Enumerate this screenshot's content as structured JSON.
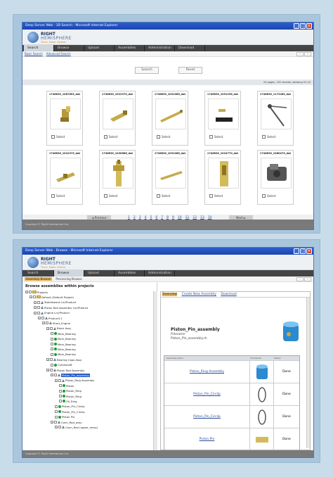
{
  "window1": {
    "title": "Deep Server Web - 3D Search - Microsoft Internet Explorer",
    "brand_line1": "RIGHT",
    "brand_line2": "HEMISPHERE",
    "brand_line3": "Think. Make. Deliver.",
    "tabs": [
      "Search",
      "Browse",
      "Upload",
      "Assemblies",
      "Administration",
      "Download"
    ],
    "subnav": {
      "basic": "Basic Search",
      "advanced": "Advanced Search"
    },
    "search_button": "Search",
    "reset_button": "Reset",
    "results_text": "10 pages, 152 records, showing 01-10",
    "items": [
      {
        "title": "1746630_1087853_dat",
        "select": "Select"
      },
      {
        "title": "1746630_1022370_dat",
        "select": "Select"
      },
      {
        "title": "1746630_1091066_dat",
        "select": "Select"
      },
      {
        "title": "1746630_1091236_dat",
        "select": "Select"
      },
      {
        "title": "1746630_1172260_dat",
        "select": "Select"
      },
      {
        "title": "1746630_1022379_dat",
        "select": "Select"
      },
      {
        "title": "1746630_1030666_dat",
        "select": "Select"
      },
      {
        "title": "1746630_1091066_dat",
        "select": "Select"
      },
      {
        "title": "1746630_1024770_dat",
        "select": "Select"
      },
      {
        "title": "1746630_1080470_dat",
        "select": "Select"
      }
    ],
    "pager": {
      "previous": "◄ Previous",
      "next": "Next ►",
      "pages": [
        "1",
        "2",
        "3",
        "4",
        "5",
        "6",
        "7",
        "8",
        "9",
        "10",
        "11",
        "12",
        "13",
        "14"
      ]
    },
    "footer": "Copyright © Right Hemisphere Ltd."
  },
  "window2": {
    "title": "Deep Server Web - Browse - Microsoft Internet Explorer",
    "brand_line1": "RIGHT",
    "brand_line2": "HEMISPHERE",
    "brand_line3": "Think. Make. Deliver.",
    "tabs": [
      "Search",
      "Browse",
      "Upload",
      "Assemblies",
      "Administration"
    ],
    "subnav": {
      "assembly": "Assembly Browse",
      "processing": "Processing Browse"
    },
    "left_title": "Browse assemblies within projects",
    "tree": [
      {
        "label": "Projects",
        "kind": "fold",
        "depth": 0
      },
      {
        "label": "Default (Default Project)",
        "kind": "fold",
        "depth": 1
      },
      {
        "label": "Stabilizeant Lnr/Product",
        "kind": "asm",
        "depth": 2
      },
      {
        "label": "Piston Rod Assembly Lnr/Product",
        "kind": "asm",
        "depth": 2
      },
      {
        "label": "Engine Lnr/Product",
        "kind": "asm",
        "depth": 2
      },
      {
        "label": "Product11",
        "kind": "asm",
        "depth": 3
      },
      {
        "label": "Short_Engine",
        "kind": "asm",
        "depth": 4
      },
      {
        "label": "Block Assy",
        "kind": "asm",
        "depth": 5
      },
      {
        "label": "Main_Bearing",
        "kind": "part",
        "depth": 6
      },
      {
        "label": "Main_Bearing",
        "kind": "part",
        "depth": 6
      },
      {
        "label": "Main_Bearing",
        "kind": "part",
        "depth": 6
      },
      {
        "label": "Main_Bearing",
        "kind": "part",
        "depth": 6
      },
      {
        "label": "Main_Bearing",
        "kind": "part",
        "depth": 6
      },
      {
        "label": "Bearing Caps Assy",
        "kind": "asm",
        "depth": 5
      },
      {
        "label": "Crankshaft",
        "kind": "part",
        "depth": 6
      },
      {
        "label": "Piston Rod Assembly",
        "kind": "asm",
        "depth": 5
      },
      {
        "label": "Piston_Pin_assembly",
        "kind": "asm",
        "depth": 6,
        "selected": true
      },
      {
        "label": "Piston_Ring Assembly",
        "kind": "asm",
        "depth": 7
      },
      {
        "label": "Piston",
        "kind": "part",
        "depth": 8
      },
      {
        "label": "Piston_Ring",
        "kind": "part",
        "depth": 8
      },
      {
        "label": "Piston_Ring",
        "kind": "part",
        "depth": 8
      },
      {
        "label": "Oil_Ring",
        "kind": "part",
        "depth": 8
      },
      {
        "label": "Piston_Pin_Circlip",
        "kind": "part",
        "depth": 7
      },
      {
        "label": "Piston_Pin_Circlip",
        "kind": "part",
        "depth": 7
      },
      {
        "label": "Piston Pin",
        "kind": "part",
        "depth": 7
      },
      {
        "label": "Conn_Rod_assy",
        "kind": "asm",
        "depth": 6
      },
      {
        "label": "Conn_Rod (upper_mass)",
        "kind": "asm",
        "depth": 7
      }
    ],
    "right_tabs": {
      "overview": "Overview",
      "create": "Create New Assembly",
      "download": "Download"
    },
    "assembly_name": "Piston_Pin_assembly",
    "filename_label": "Filename",
    "filename_value": "Piston_Pin_assembly.rh",
    "table_headers": [
      "Assembly Items",
      "Thumbnail",
      "Status"
    ],
    "table_rows": [
      {
        "name": "Piston_Ring Assembly",
        "status": "Done"
      },
      {
        "name": "Piston_Pin_Circlip",
        "status": "Done"
      },
      {
        "name": "Piston_Pin_Circlip",
        "status": "Done"
      },
      {
        "name": "Piston Pin",
        "status": "Done"
      }
    ],
    "footer": "Copyright © Right Hemisphere Ltd."
  }
}
